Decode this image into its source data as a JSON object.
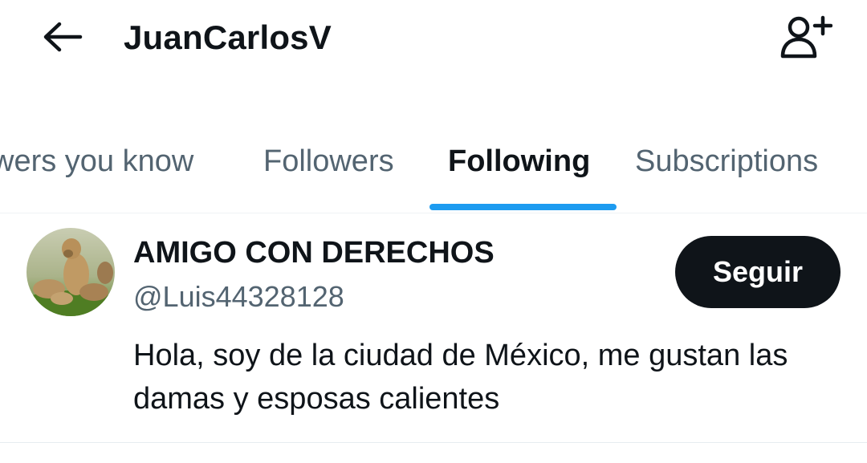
{
  "header": {
    "back_icon": "arrow-left-icon",
    "title": "JuanCarlosV",
    "add_user_icon": "person-plus-icon"
  },
  "tabs": [
    {
      "label": "Followers you know",
      "visible_text": "wers you know",
      "active": false
    },
    {
      "label": "Followers",
      "visible_text": "Followers",
      "active": false
    },
    {
      "label": "Following",
      "visible_text": "Following",
      "active": true
    },
    {
      "label": "Subscriptions",
      "visible_text": "Subscriptions",
      "active": false
    }
  ],
  "users": [
    {
      "display_name": "AMIGO CON DERECHOS",
      "handle": "@Luis44328128",
      "follow_label": "Seguir",
      "bio": "Hola, soy de la ciudad de México, me gustan las damas y esposas calientes"
    }
  ],
  "colors": {
    "accent": "#1d9bf0",
    "text_primary": "#0f1419",
    "text_secondary": "#536471",
    "button_bg": "#0f1419"
  }
}
